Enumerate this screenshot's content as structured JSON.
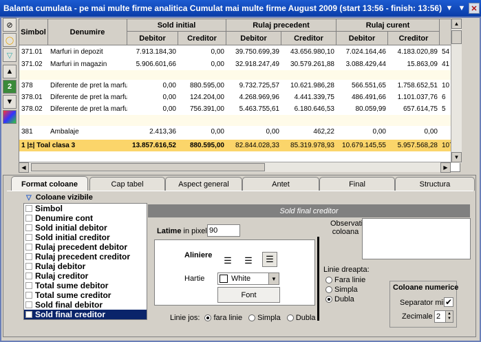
{
  "window": {
    "title": "Balanta cumulata - pe mai multe firme analitica Cumulat mai multe firme  August 2009 (start 13:56 - finish: 13:56)"
  },
  "grid": {
    "headers": {
      "simbol": "Simbol",
      "denumire": "Denumire",
      "sold_initial": "Sold   initial",
      "rulaj_precedent": "Rulaj   precedent",
      "rulaj_curent": "Rulaj   curent",
      "debitor": "Debitor",
      "creditor": "Creditor"
    },
    "rows": [
      {
        "simbol": "371.01",
        "denumire": "Marfuri in depozit",
        "si_deb": "7.913.184,30",
        "si_cred": "0,00",
        "rp_deb": "39.750.699,39",
        "rp_cred": "43.656.980,10",
        "rc_deb": "7.024.164,46",
        "rc_cred": "4.183.020,89",
        "extra": "54"
      },
      {
        "simbol": "371.02",
        "denumire": "Marfuri in magazin",
        "si_deb": "5.906.601,66",
        "si_cred": "0,00",
        "rp_deb": "32.918.247,49",
        "rp_cred": "30.579.261,88",
        "rc_deb": "3.088.429,44",
        "rc_cred": "15.863,09",
        "extra": "41"
      },
      {
        "simbol": "378",
        "denumire": "Diferente de pret la marfuri",
        "si_deb": "0,00",
        "si_cred": "880.595,00",
        "rp_deb": "9.732.725,57",
        "rp_cred": "10.621.986,28",
        "rc_deb": "566.551,65",
        "rc_cred": "1.758.652,51",
        "extra": "10"
      },
      {
        "simbol": "378.01",
        "denumire": "Diferente de pret la marfuri",
        "si_deb": "0,00",
        "si_cred": "124.204,00",
        "rp_deb": "4.268.969,96",
        "rp_cred": "4.441.339,75",
        "rc_deb": "486.491,66",
        "rc_cred": "1.101.037,76",
        "extra": "6"
      },
      {
        "simbol": "378.02",
        "denumire": "Diferente de pret la marfuri",
        "si_deb": "0,00",
        "si_cred": "756.391,00",
        "rp_deb": "5.463.755,61",
        "rp_cred": "6.180.646,53",
        "rc_deb": "80.059,99",
        "rc_cred": "657.614,75",
        "extra": "5"
      },
      {
        "simbol": "381",
        "denumire": "Ambalaje",
        "si_deb": "2.413,36",
        "si_cred": "0,00",
        "rp_deb": "0,00",
        "rp_cred": "462,22",
        "rc_deb": "0,00",
        "rc_cred": "0,00",
        "extra": ""
      }
    ],
    "total": {
      "label": "1 |±| Toal clasa  3",
      "si_deb": "13.857.616,52",
      "si_cred": "880.595,00",
      "rp_deb": "82.844.028,33",
      "rp_cred": "85.319.978,93",
      "rc_deb": "10.679.145,55",
      "rc_cred": "5.957.568,28",
      "extra": "107"
    }
  },
  "tabs": [
    "Format coloane",
    "Cap tabel",
    "Aspect general",
    "Antet",
    "Final",
    "Structura"
  ],
  "active_tab": "Format coloane",
  "section_title": "Coloane vizibile",
  "columns": [
    "Simbol",
    "Denumire cont",
    "Sold initial debitor",
    "Sold initial creditor",
    "Rulaj precedent debitor",
    "Rulaj precedent creditor",
    "Rulaj debitor",
    "Rulaj creditor",
    "Total sume debitor",
    "Total sume creditor",
    "Sold final debitor",
    "Sold final creditor"
  ],
  "panel": {
    "title": "Sold final creditor",
    "latime_label": "Latime",
    "latime_unit": "in pixeli",
    "latime_value": "90",
    "aliniere_label": "Aliniere",
    "hartie_label": "Hartie",
    "hartie_value": "White",
    "font_button": "Font",
    "linie_jos_label": "Linie jos:",
    "linie_jos_options": [
      "fara linie",
      "Simpla",
      "Dubla"
    ],
    "observatii_label": "Observatii coloana",
    "linie_dreapta_label": "Linie dreapta:",
    "linie_dreapta_options": [
      "Fara linie",
      "Simpla",
      "Dubla"
    ],
    "numerice_title": "Coloane numerice",
    "separator_label": "Separator mii?",
    "zecimale_label": "Zecimale",
    "zecimale_value": "2"
  }
}
